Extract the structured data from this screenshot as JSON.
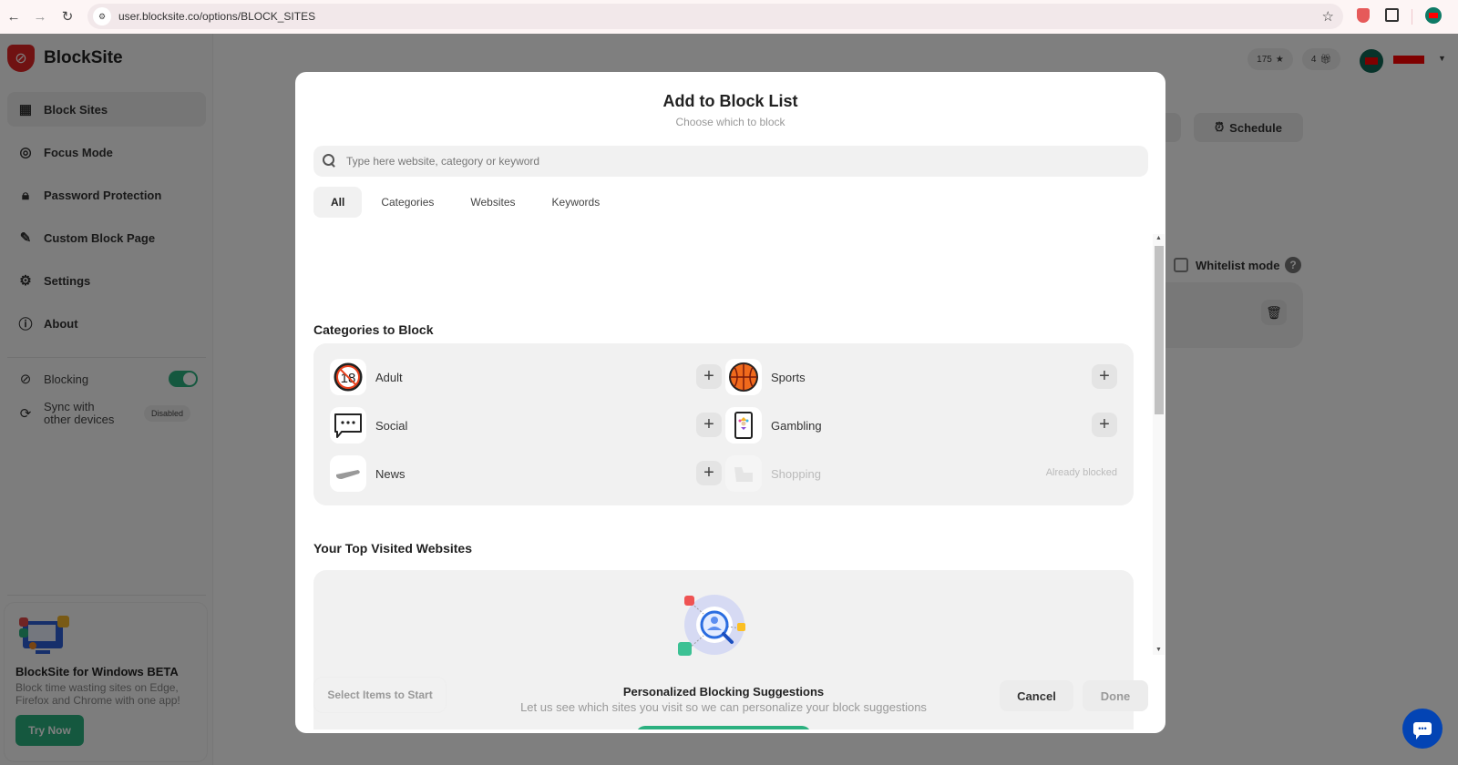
{
  "browser": {
    "url": "user.blocksite.co/options/BLOCK_SITES"
  },
  "app": {
    "brand": "BlockSite",
    "sidebar": {
      "items": [
        {
          "label": "Block Sites",
          "icon": "grid-block-icon",
          "active": true
        },
        {
          "label": "Focus Mode",
          "icon": "target-icon"
        },
        {
          "label": "Password Protection",
          "icon": "lock-icon"
        },
        {
          "label": "Custom Block Page",
          "icon": "edit-page-icon"
        },
        {
          "label": "Settings",
          "icon": "gear-icon"
        },
        {
          "label": "About",
          "icon": "info-icon"
        }
      ],
      "blocking_label": "Blocking",
      "blocking_enabled": true,
      "sync_label_line1": "Sync with",
      "sync_label_line2": "other devices",
      "sync_status": "Disabled",
      "promo": {
        "title": "BlockSite for Windows BETA",
        "text": "Block time wasting sites on Edge, Firefox and Chrome with one app!",
        "button": "Try Now"
      }
    },
    "topbar": {
      "points": "175",
      "gifts": "4"
    },
    "main": {
      "schedule_label": "Schedule",
      "whitelist_label": "Whitelist mode",
      "whitelist_help": "?"
    }
  },
  "modal": {
    "title": "Add to Block List",
    "subtitle": "Choose which to block",
    "search_placeholder": "Type here website, category or keyword",
    "tabs": [
      {
        "label": "All",
        "active": true
      },
      {
        "label": "Categories"
      },
      {
        "label": "Websites"
      },
      {
        "label": "Keywords"
      }
    ],
    "categories_title": "Categories to Block",
    "categories": [
      {
        "label": "Adult",
        "icon": "no-18-icon",
        "status": "add"
      },
      {
        "label": "Sports",
        "icon": "basketball-icon",
        "status": "add"
      },
      {
        "label": "Social",
        "icon": "speech-bubble-icon",
        "status": "add"
      },
      {
        "label": "Gambling",
        "icon": "joker-card-icon",
        "status": "add"
      },
      {
        "label": "News",
        "icon": "megaphone-icon",
        "status": "add"
      },
      {
        "label": "Shopping",
        "icon": "shopping-icon",
        "status": "blocked",
        "status_text": "Already blocked"
      }
    ],
    "top_sites_title": "Your Top Visited Websites",
    "suggestions": {
      "title": "Personalized Blocking Suggestions",
      "text": "Let us see which sites you visit so we can personalize your block suggestions"
    },
    "footer": {
      "status": "Select Items to Start",
      "cancel": "Cancel",
      "done": "Done"
    }
  },
  "colors": {
    "accent_green": "#2bb07f",
    "brand_red": "#e02424",
    "chat_blue": "#0344b4"
  }
}
